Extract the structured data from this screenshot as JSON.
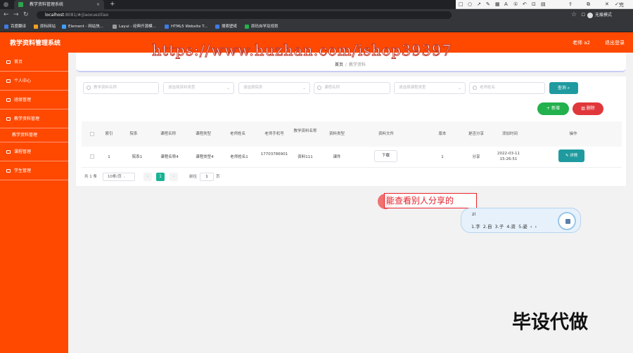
{
  "browser": {
    "tab_title": "教学资料管理系统",
    "tab_close": "×",
    "new_tab": "+",
    "url_host": "localhost",
    "url_path": ":8081/#/jiaoxueziliao",
    "profile_label": "无痕模式",
    "bookmarks": [
      "百度翻译",
      "原标网站",
      "Element - 网站快...",
      "Layui - 经典开源模...",
      "HTML5 Website T...",
      "搜索壁纸",
      "原码自学及规划"
    ]
  },
  "annotation_toolbar": {
    "done_label": "完成",
    "font_size": "20",
    "selected_color": "#ff2b2b",
    "palette": [
      "#000000",
      "#555555",
      "#880000",
      "#886600",
      "#008800",
      "#004488",
      "#000088",
      "#660088",
      "#ffffff",
      "#aaaaaa",
      "#ff2b2b",
      "#ffcc00",
      "#22cc22",
      "#22cccc",
      "#2244ff",
      "#cc22cc"
    ]
  },
  "header": {
    "title": "教学资料管理系统",
    "user": "老师 a2",
    "logout": "退出登录",
    "color": "#ff4800"
  },
  "sidebar": {
    "items": [
      {
        "label": "首页",
        "icon": "home-icon"
      },
      {
        "label": "个人中心",
        "icon": "user-icon"
      },
      {
        "label": "班级管理",
        "icon": "class-icon"
      },
      {
        "label": "教学资料管理",
        "icon": "folder-icon"
      },
      {
        "label": "课程管理",
        "icon": "book-icon"
      },
      {
        "label": "学生管理",
        "icon": "group-icon"
      }
    ],
    "sub_item": "教学资料管理"
  },
  "breadcrumb": {
    "home": "首页",
    "sep": "/",
    "current": "教学资料"
  },
  "filters": [
    {
      "placeholder": "教学资料名称",
      "type": "search"
    },
    {
      "placeholder": "请选择资料类型",
      "type": "select"
    },
    {
      "placeholder": "请选择院系",
      "type": "select"
    },
    {
      "placeholder": "课程名称",
      "type": "search"
    },
    {
      "placeholder": "请选择课程类型",
      "type": "select"
    },
    {
      "placeholder": "老师姓名",
      "type": "search"
    }
  ],
  "buttons": {
    "query": "查询",
    "add": "新增",
    "delete": "删除",
    "download": "下载",
    "detail": "详情"
  },
  "table": {
    "headers": [
      "索引",
      "院系",
      "课程名称",
      "课程类型",
      "老师姓名",
      "老师手机号",
      "教学资料名称",
      "资料类型",
      "资料文件",
      "版本",
      "是否分享",
      "添加时间",
      "操作"
    ],
    "rows": [
      {
        "index": "1",
        "yuanxi": "院系1",
        "kecheng": "课程名称4",
        "leixing": "课程类型4",
        "laoshi": "老师姓名1",
        "phone": "17703786901",
        "ziliao": "资料111",
        "ziliao_type": "课件",
        "banben": "1",
        "share": "分享",
        "time": "2022-03-11 15:26:51"
      }
    ]
  },
  "pagination": {
    "total": "共 1 条",
    "page_size": "10条/页",
    "current": "1",
    "prev": "‹",
    "next": "›",
    "goto_label": "前往",
    "goto_value": "1",
    "page_suffix": "页"
  },
  "overlay": {
    "watermark": "https://www.huzhan.com/ishop39397",
    "annotation_text": "能查看别人分享的",
    "ime_composition": "zi",
    "ime_candidates": "1.字 2.自 3.子 4.资 5.姿 ‹ ›",
    "corner_mark": "毕设代做"
  }
}
